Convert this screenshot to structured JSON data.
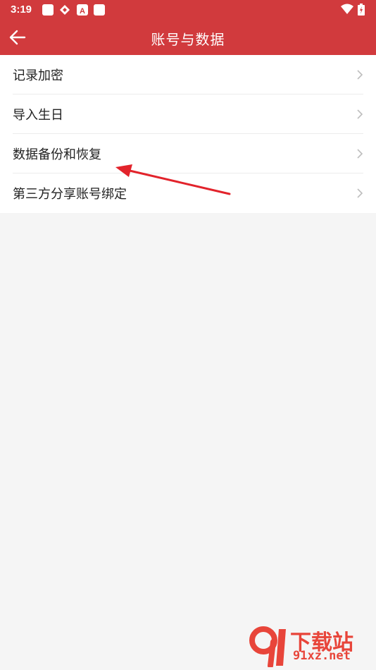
{
  "status_bar": {
    "time": "3:19",
    "left_icons": [
      "app-square-icon",
      "app-diamond-icon",
      "app-a-icon",
      "app-square-icon"
    ],
    "right_icons": [
      "wifi-icon",
      "battery-icon"
    ]
  },
  "app_bar": {
    "title": "账号与数据",
    "back_icon": "arrow-left-icon",
    "background_color": "#d13a3d"
  },
  "menu": {
    "items": [
      {
        "label": "记录加密"
      },
      {
        "label": "导入生日"
      },
      {
        "label": "数据备份和恢复"
      },
      {
        "label": "第三方分享账号绑定"
      }
    ]
  },
  "annotation": {
    "arrow_color": "#e2232b"
  },
  "watermark": {
    "line1": "下载站",
    "line2": "91xz.net",
    "color": "#e8453a"
  }
}
